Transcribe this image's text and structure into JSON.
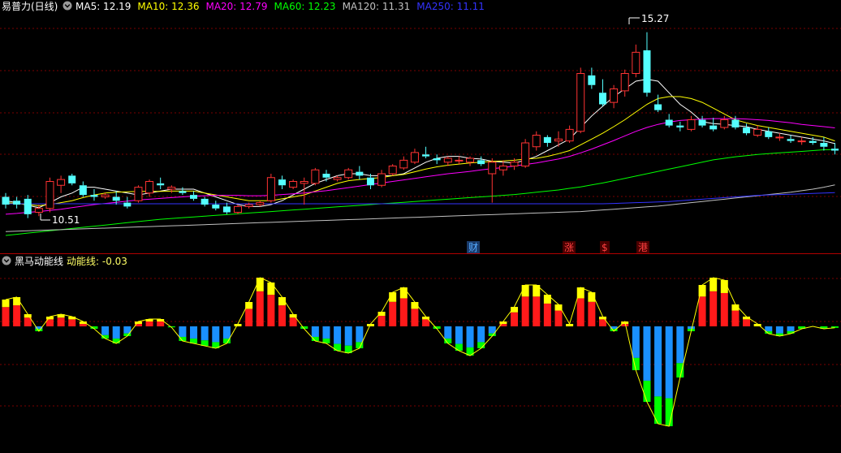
{
  "header": {
    "title": "易普力(日线)",
    "ma": [
      {
        "label": "MA5: 12.19",
        "color": "#ffffff"
      },
      {
        "label": "MA10: 12.36",
        "color": "#ffff00"
      },
      {
        "label": "MA20: 12.79",
        "color": "#ff00ff"
      },
      {
        "label": "MA60: 12.23",
        "color": "#00ff00"
      },
      {
        "label": "MA120: 11.31",
        "color": "#c0c0c0"
      },
      {
        "label": "MA250: 11.11",
        "color": "#3333ff"
      }
    ]
  },
  "annotations": {
    "high": "15.27",
    "low": "10.51",
    "markers": [
      {
        "label": "财",
        "color": "#55aaff"
      },
      {
        "label": "涨",
        "color": "#ff4040"
      },
      {
        "label": "$",
        "color": "#ff4040"
      },
      {
        "label": "港",
        "color": "#ff4040"
      }
    ]
  },
  "indicator": {
    "title": "黑马动能线",
    "value_label": "动能线: -0.03"
  },
  "colors": {
    "up": "#ff3333",
    "down": "#54ffff",
    "osc_pos": "#ff1a1a",
    "osc_pos_cap": "#ffff00",
    "osc_neg": "#1a90ff",
    "osc_neg_cap": "#00ff00",
    "grid": "#7a0000"
  },
  "chart_data": [
    {
      "type": "candlestick",
      "title": "易普力(日线)",
      "ylim": [
        10.0,
        15.6
      ],
      "candles": [
        [
          11.0,
          11.1,
          10.7,
          10.8
        ],
        [
          10.9,
          11.0,
          10.7,
          10.8
        ],
        [
          10.95,
          11.05,
          10.45,
          10.55
        ],
        [
          10.6,
          10.8,
          10.5,
          10.7
        ],
        [
          10.7,
          11.5,
          10.6,
          11.4
        ],
        [
          11.3,
          11.55,
          11.1,
          11.45
        ],
        [
          11.55,
          11.6,
          11.3,
          11.35
        ],
        [
          11.3,
          11.4,
          11.0,
          11.05
        ],
        [
          11.05,
          11.2,
          10.9,
          11.0
        ],
        [
          11.0,
          11.1,
          10.95,
          11.05
        ],
        [
          11.0,
          11.15,
          10.8,
          10.9
        ],
        [
          10.85,
          11.0,
          10.7,
          10.75
        ],
        [
          10.9,
          11.3,
          10.85,
          11.25
        ],
        [
          11.1,
          11.45,
          11.0,
          11.4
        ],
        [
          11.35,
          11.5,
          11.2,
          11.3
        ],
        [
          11.2,
          11.3,
          11.1,
          11.25
        ],
        [
          11.15,
          11.25,
          11.05,
          11.1
        ],
        [
          11.05,
          11.15,
          10.9,
          10.95
        ],
        [
          10.95,
          11.0,
          10.75,
          10.8
        ],
        [
          10.8,
          10.9,
          10.65,
          10.7
        ],
        [
          10.75,
          10.85,
          10.55,
          10.6
        ],
        [
          10.6,
          10.8,
          10.55,
          10.75
        ],
        [
          10.75,
          10.85,
          10.7,
          10.8
        ],
        [
          10.8,
          10.9,
          10.75,
          10.85
        ],
        [
          10.9,
          11.6,
          10.85,
          11.5
        ],
        [
          11.45,
          11.55,
          11.2,
          11.3
        ],
        [
          11.25,
          11.45,
          11.2,
          11.4
        ],
        [
          11.35,
          11.5,
          10.8,
          11.4
        ],
        [
          11.35,
          11.75,
          11.3,
          11.7
        ],
        [
          11.6,
          11.7,
          11.4,
          11.5
        ],
        [
          11.45,
          11.55,
          11.4,
          11.5
        ],
        [
          11.5,
          11.75,
          11.45,
          11.7
        ],
        [
          11.65,
          11.8,
          11.45,
          11.55
        ],
        [
          11.5,
          11.6,
          11.2,
          11.3
        ],
        [
          11.3,
          11.7,
          11.25,
          11.6
        ],
        [
          11.6,
          11.85,
          11.55,
          11.8
        ],
        [
          11.75,
          12.05,
          11.7,
          11.95
        ],
        [
          11.9,
          12.25,
          11.85,
          12.15
        ],
        [
          12.1,
          12.3,
          12.0,
          12.05
        ],
        [
          12.0,
          12.1,
          11.85,
          11.95
        ],
        [
          11.9,
          12.05,
          11.8,
          12.0
        ],
        [
          11.95,
          12.05,
          11.85,
          11.95
        ],
        [
          11.9,
          12.05,
          11.8,
          12.0
        ],
        [
          11.95,
          12.05,
          11.8,
          11.85
        ],
        [
          11.6,
          12.0,
          10.85,
          11.9
        ],
        [
          11.7,
          11.95,
          11.55,
          11.8
        ],
        [
          11.8,
          12.0,
          11.7,
          11.9
        ],
        [
          11.8,
          12.5,
          11.75,
          12.4
        ],
        [
          12.3,
          12.7,
          12.2,
          12.6
        ],
        [
          12.55,
          12.6,
          12.3,
          12.4
        ],
        [
          12.45,
          12.7,
          12.3,
          12.5
        ],
        [
          12.45,
          12.85,
          12.4,
          12.75
        ],
        [
          12.7,
          14.35,
          12.65,
          14.2
        ],
        [
          14.15,
          14.35,
          13.8,
          13.9
        ],
        [
          13.7,
          14.05,
          13.35,
          13.4
        ],
        [
          13.45,
          13.9,
          13.3,
          13.8
        ],
        [
          13.75,
          14.3,
          13.6,
          14.2
        ],
        [
          14.2,
          14.95,
          14.1,
          14.75
        ],
        [
          14.8,
          15.27,
          13.6,
          13.7
        ],
        [
          13.4,
          13.65,
          13.2,
          13.25
        ],
        [
          13.0,
          13.15,
          12.8,
          12.85
        ],
        [
          12.85,
          12.95,
          12.7,
          12.8
        ],
        [
          12.75,
          13.1,
          12.7,
          13.0
        ],
        [
          13.0,
          13.1,
          12.8,
          12.85
        ],
        [
          12.85,
          13.05,
          12.7,
          12.75
        ],
        [
          12.8,
          13.1,
          12.75,
          13.0
        ],
        [
          13.0,
          13.1,
          12.75,
          12.8
        ],
        [
          12.8,
          12.9,
          12.6,
          12.65
        ],
        [
          12.6,
          12.85,
          12.55,
          12.75
        ],
        [
          12.7,
          12.8,
          12.5,
          12.55
        ],
        [
          12.55,
          12.65,
          12.45,
          12.55
        ],
        [
          12.5,
          12.6,
          12.4,
          12.45
        ],
        [
          12.45,
          12.55,
          12.35,
          12.45
        ],
        [
          12.45,
          12.55,
          12.35,
          12.4
        ],
        [
          12.4,
          12.55,
          12.2,
          12.3
        ],
        [
          12.25,
          12.4,
          12.1,
          12.2
        ]
      ],
      "series": [
        {
          "name": "MA5",
          "values": [
            10.9,
            10.85,
            10.78,
            10.72,
            10.85,
            11.0,
            11.1,
            11.25,
            11.25,
            11.2,
            11.15,
            11.1,
            11.05,
            11.1,
            11.15,
            11.2,
            11.2,
            11.2,
            11.1,
            11.0,
            10.9,
            10.8,
            10.75,
            10.75,
            10.8,
            10.9,
            11.05,
            11.2,
            11.35,
            11.45,
            11.55,
            11.6,
            11.6,
            11.55,
            11.55,
            11.55,
            11.6,
            11.75,
            11.9,
            12.0,
            12.05,
            12.05,
            12.0,
            11.98,
            11.92,
            11.9,
            11.88,
            11.95,
            12.05,
            12.2,
            12.35,
            12.5,
            12.8,
            13.1,
            13.35,
            13.6,
            13.8,
            14.0,
            14.05,
            14.0,
            13.7,
            13.4,
            13.2,
            12.95,
            12.9,
            12.88,
            12.85,
            12.82,
            12.75,
            12.7,
            12.65,
            12.6,
            12.55,
            12.5,
            12.45,
            12.38
          ]
        },
        {
          "name": "MA10",
          "values": [
            10.85,
            10.83,
            10.8,
            10.77,
            10.8,
            10.85,
            10.9,
            10.98,
            11.05,
            11.1,
            11.12,
            11.13,
            11.14,
            11.14,
            11.14,
            11.15,
            11.15,
            11.15,
            11.1,
            11.05,
            11.0,
            10.95,
            10.9,
            10.9,
            10.9,
            10.95,
            11.0,
            11.05,
            11.15,
            11.25,
            11.35,
            11.42,
            11.45,
            11.48,
            11.5,
            11.55,
            11.58,
            11.65,
            11.72,
            11.78,
            11.82,
            11.85,
            11.88,
            11.9,
            11.92,
            11.93,
            11.95,
            11.98,
            12.0,
            12.05,
            12.12,
            12.2,
            12.35,
            12.5,
            12.65,
            12.82,
            13.0,
            13.2,
            13.4,
            13.55,
            13.6,
            13.6,
            13.55,
            13.45,
            13.3,
            13.15,
            13.0,
            12.92,
            12.85,
            12.8,
            12.75,
            12.7,
            12.65,
            12.6,
            12.55,
            12.45
          ]
        },
        {
          "name": "MA20",
          "values": [
            10.55,
            10.57,
            10.6,
            10.62,
            10.65,
            10.68,
            10.72,
            10.76,
            10.8,
            10.83,
            10.86,
            10.89,
            10.92,
            10.94,
            10.96,
            10.98,
            11.0,
            11.02,
            11.03,
            11.04,
            11.04,
            11.04,
            11.03,
            11.03,
            11.04,
            11.06,
            11.08,
            11.1,
            11.13,
            11.16,
            11.2,
            11.24,
            11.28,
            11.32,
            11.36,
            11.4,
            11.44,
            11.48,
            11.52,
            11.56,
            11.6,
            11.63,
            11.66,
            11.7,
            11.73,
            11.76,
            11.8,
            11.84,
            11.88,
            11.93,
            11.98,
            12.05,
            12.14,
            12.24,
            12.35,
            12.46,
            12.58,
            12.7,
            12.8,
            12.88,
            12.94,
            12.98,
            13.0,
            13.02,
            13.03,
            13.03,
            13.03,
            13.02,
            13.0,
            12.98,
            12.95,
            12.92,
            12.88,
            12.85,
            12.82,
            12.79
          ]
        },
        {
          "name": "MA60",
          "values": [
            10.0,
            10.03,
            10.06,
            10.09,
            10.12,
            10.15,
            10.18,
            10.21,
            10.24,
            10.27,
            10.3,
            10.33,
            10.36,
            10.39,
            10.42,
            10.44,
            10.46,
            10.48,
            10.5,
            10.52,
            10.54,
            10.56,
            10.58,
            10.6,
            10.62,
            10.64,
            10.66,
            10.68,
            10.7,
            10.72,
            10.74,
            10.76,
            10.78,
            10.8,
            10.82,
            10.84,
            10.86,
            10.88,
            10.9,
            10.92,
            10.94,
            10.96,
            10.98,
            11.0,
            11.02,
            11.04,
            11.06,
            11.09,
            11.12,
            11.15,
            11.18,
            11.22,
            11.26,
            11.31,
            11.36,
            11.42,
            11.48,
            11.54,
            11.6,
            11.66,
            11.72,
            11.78,
            11.84,
            11.9,
            11.96,
            12.0,
            12.04,
            12.07,
            12.1,
            12.12,
            12.14,
            12.16,
            12.18,
            12.2,
            12.22,
            12.23
          ]
        },
        {
          "name": "MA120",
          "values": [
            10.1,
            10.11,
            10.12,
            10.13,
            10.14,
            10.15,
            10.16,
            10.17,
            10.18,
            10.19,
            10.2,
            10.21,
            10.22,
            10.23,
            10.24,
            10.25,
            10.26,
            10.27,
            10.28,
            10.29,
            10.3,
            10.31,
            10.32,
            10.33,
            10.34,
            10.35,
            10.36,
            10.37,
            10.38,
            10.39,
            10.4,
            10.41,
            10.42,
            10.43,
            10.44,
            10.45,
            10.46,
            10.47,
            10.48,
            10.49,
            10.5,
            10.51,
            10.52,
            10.53,
            10.54,
            10.55,
            10.56,
            10.57,
            10.58,
            10.59,
            10.6,
            10.61,
            10.62,
            10.64,
            10.66,
            10.68,
            10.7,
            10.72,
            10.74,
            10.76,
            10.79,
            10.82,
            10.85,
            10.88,
            10.91,
            10.94,
            10.97,
            11.0,
            11.03,
            11.06,
            11.09,
            11.12,
            11.16,
            11.2,
            11.25,
            11.31
          ]
        },
        {
          "name": "MA250",
          "values": [
            10.82,
            10.82,
            10.82,
            10.82,
            10.82,
            10.82,
            10.82,
            10.82,
            10.82,
            10.82,
            10.82,
            10.82,
            10.82,
            10.82,
            10.82,
            10.82,
            10.82,
            10.82,
            10.82,
            10.82,
            10.82,
            10.82,
            10.82,
            10.82,
            10.82,
            10.82,
            10.82,
            10.82,
            10.82,
            10.82,
            10.82,
            10.82,
            10.82,
            10.82,
            10.82,
            10.82,
            10.82,
            10.82,
            10.82,
            10.82,
            10.82,
            10.82,
            10.82,
            10.82,
            10.82,
            10.82,
            10.82,
            10.82,
            10.82,
            10.82,
            10.82,
            10.82,
            10.82,
            10.82,
            10.82,
            10.83,
            10.84,
            10.85,
            10.86,
            10.87,
            10.88,
            10.9,
            10.92,
            10.94,
            10.96,
            10.98,
            11.0,
            11.02,
            11.04,
            11.05,
            11.06,
            11.07,
            11.08,
            11.09,
            11.1,
            11.11
          ]
        }
      ]
    },
    {
      "type": "bar",
      "title": "黑马动能线",
      "ylim": [
        -2.5,
        1.2
      ],
      "values": [
        0.55,
        0.6,
        0.25,
        -0.1,
        0.2,
        0.25,
        0.2,
        0.1,
        -0.05,
        -0.25,
        -0.35,
        -0.2,
        0.1,
        0.15,
        0.15,
        -0.02,
        -0.3,
        -0.35,
        -0.4,
        -0.45,
        -0.35,
        0.05,
        0.5,
        1.0,
        0.9,
        0.6,
        0.25,
        -0.05,
        -0.3,
        -0.35,
        -0.5,
        -0.55,
        -0.45,
        0.05,
        0.3,
        0.7,
        0.8,
        0.5,
        0.2,
        -0.05,
        -0.35,
        -0.5,
        -0.6,
        -0.45,
        -0.2,
        0.1,
        0.4,
        0.85,
        0.85,
        0.65,
        0.45,
        0.05,
        0.8,
        0.7,
        0.2,
        -0.1,
        0.1,
        -0.9,
        -1.55,
        -2.0,
        -2.05,
        -1.05,
        -0.1,
        0.85,
        1.0,
        0.95,
        0.45,
        0.2,
        0.05,
        -0.15,
        -0.2,
        -0.15,
        -0.05,
        0.0,
        -0.05,
        -0.03
      ]
    }
  ]
}
